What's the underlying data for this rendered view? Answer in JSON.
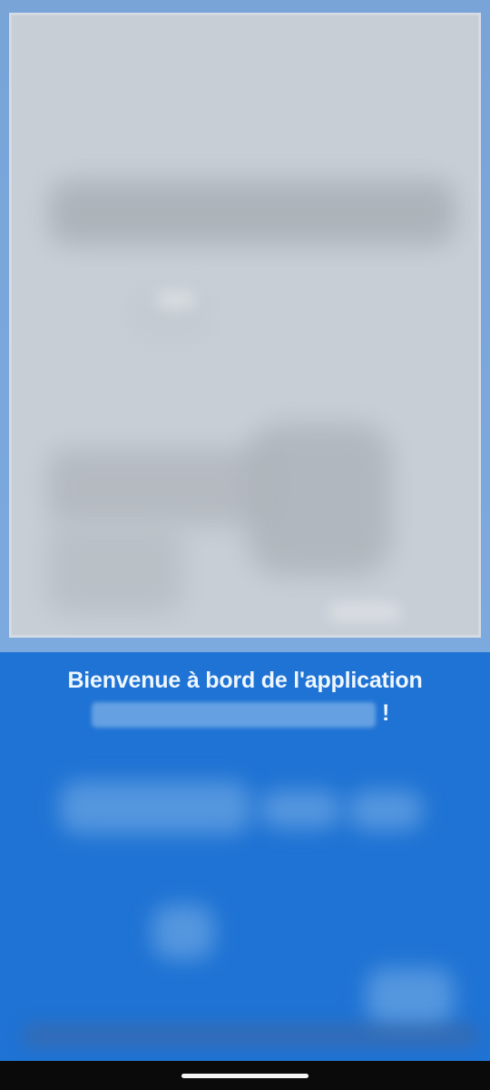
{
  "screen": {
    "welcome_text": "Bienvenue à bord de l'application",
    "exclamation": "!"
  },
  "colors": {
    "top_frame_blue": "#79a4d8",
    "main_blue": "#1f73d4",
    "preview_gray": "#c8ced6",
    "text_light": "#eef6ff",
    "nav_black": "#0a0a0a"
  },
  "icons": {
    "gesture_indicator": "gesture-handle-icon"
  }
}
